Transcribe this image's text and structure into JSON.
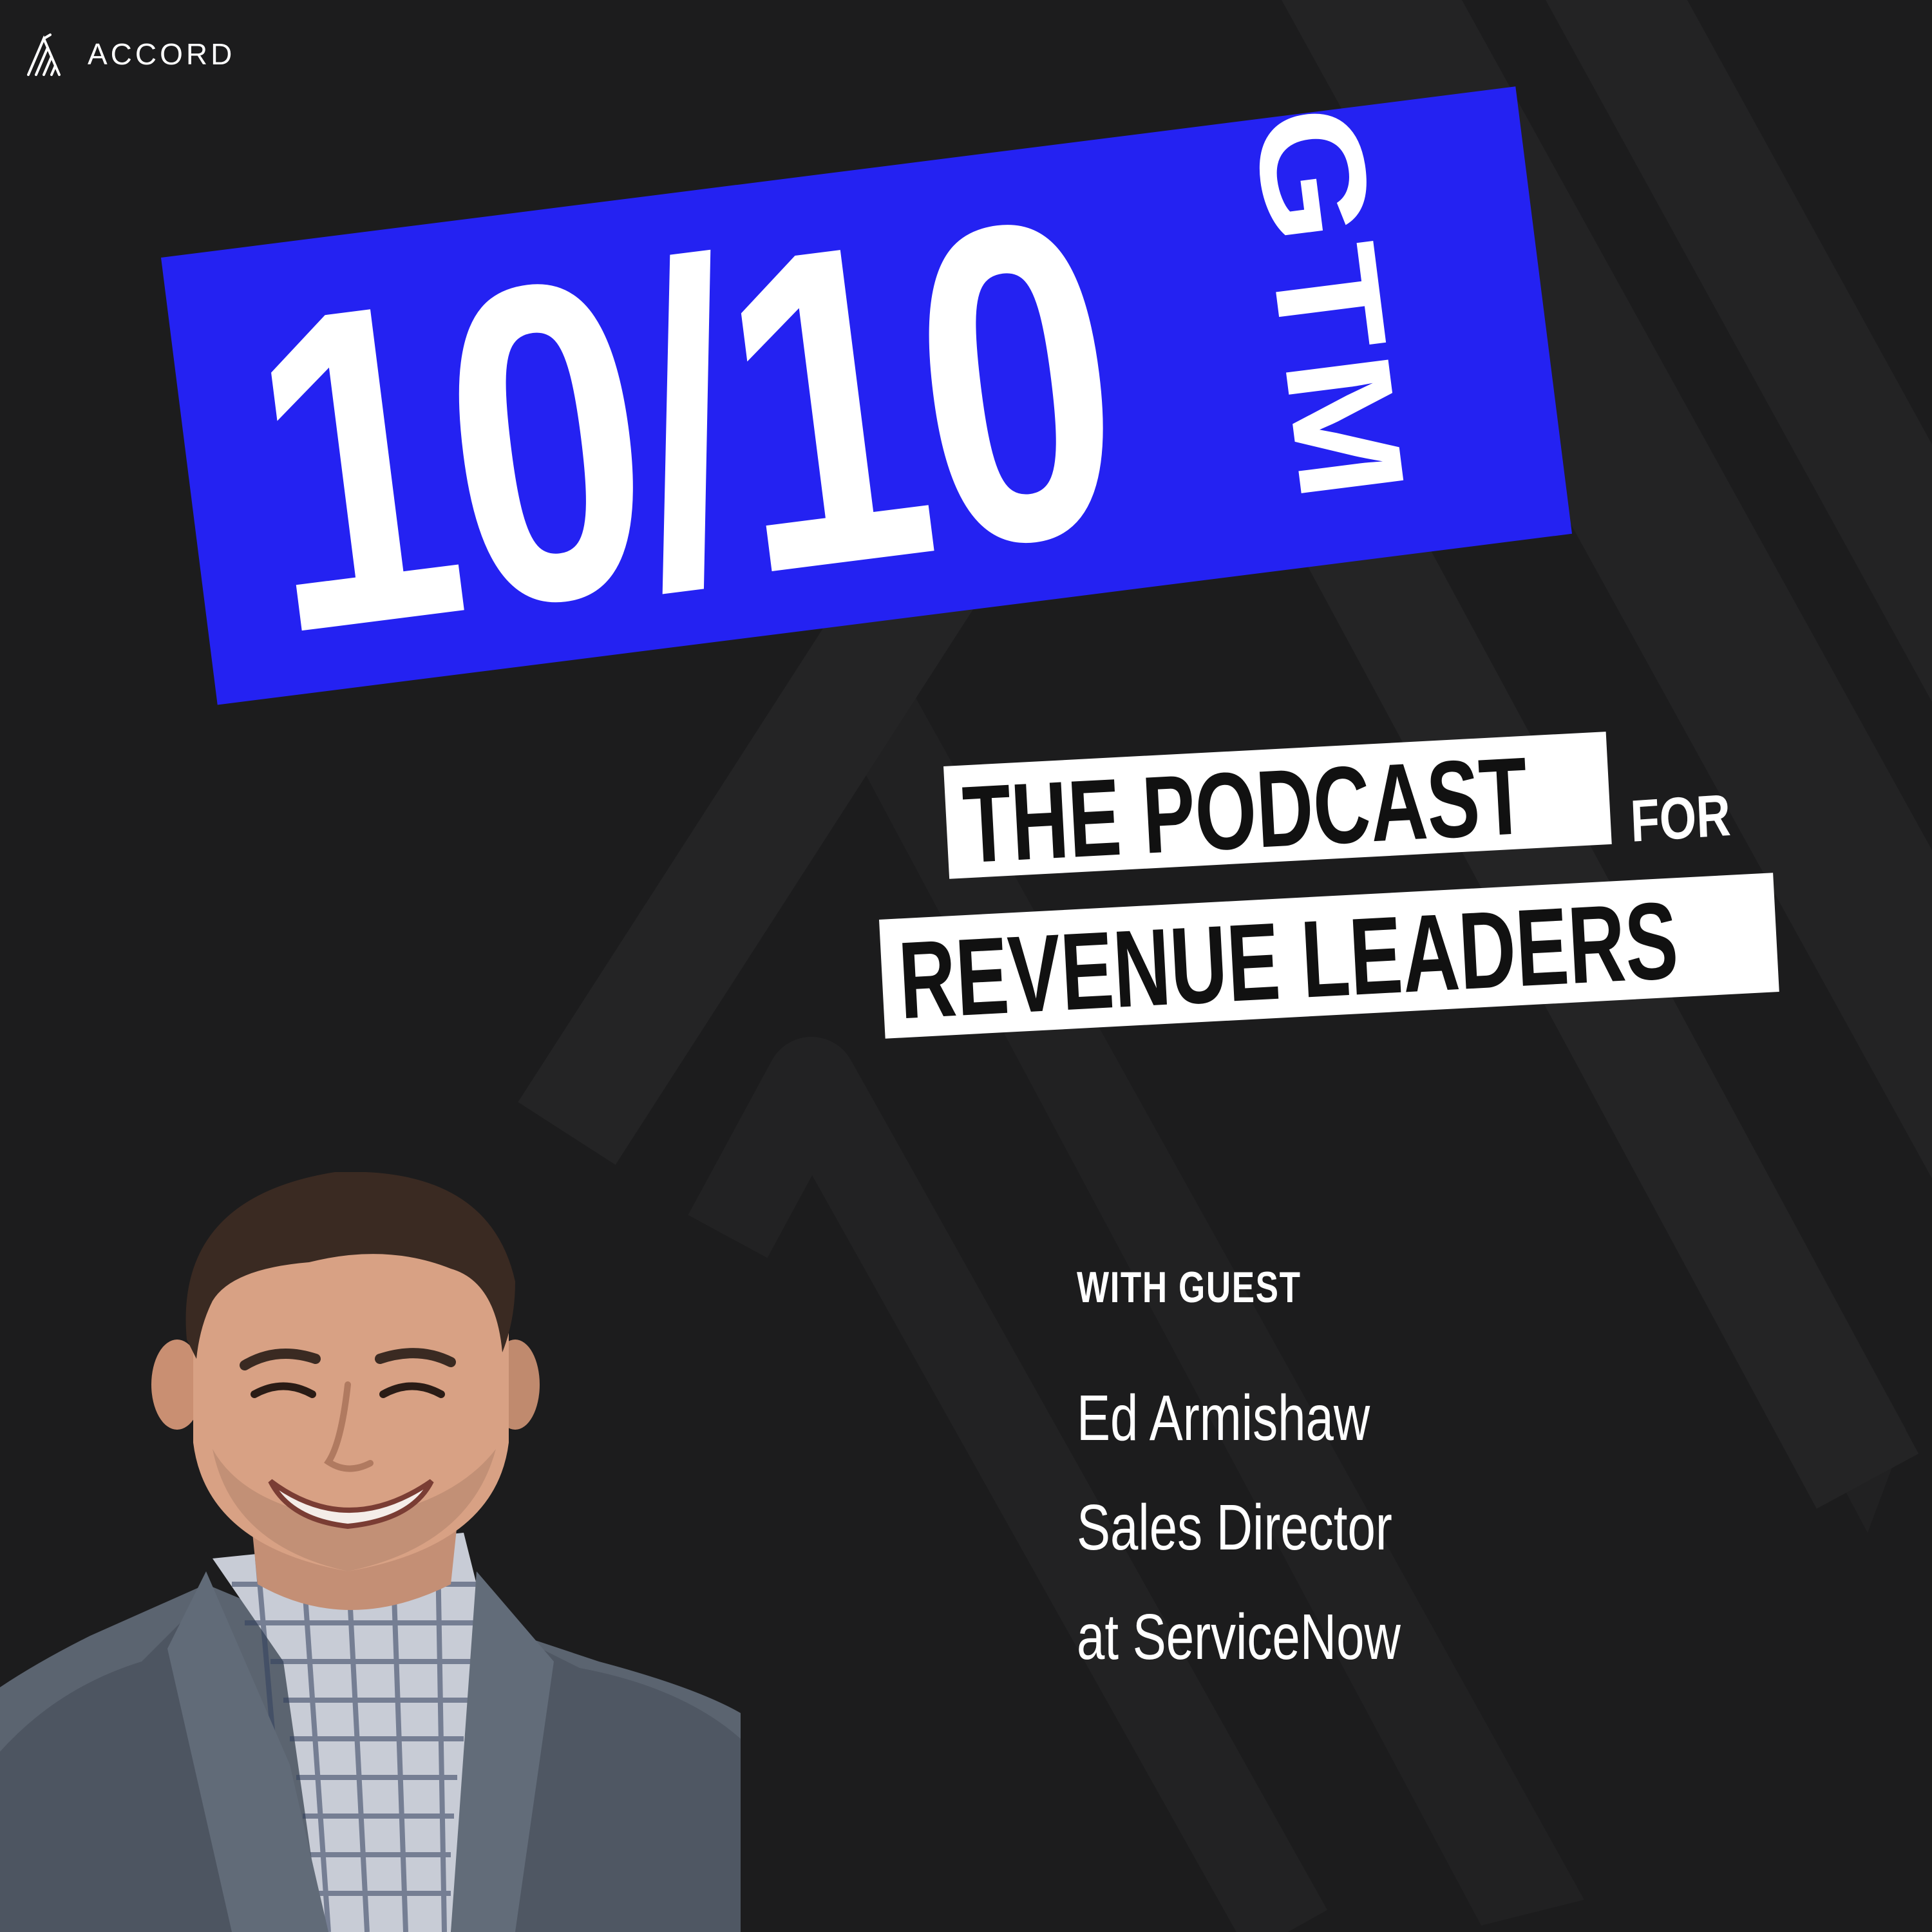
{
  "brand": {
    "name": "ACCORD",
    "logo_icon": "accord-logo-icon"
  },
  "title": {
    "main": "10/10",
    "side": "GTM"
  },
  "tagline": {
    "line1": "THE PODCAST",
    "connector": "FOR",
    "line2": "REVENUE LEADERS"
  },
  "guest": {
    "label": "WITH GUEST",
    "name": "Ed Armishaw",
    "role": "Sales Director",
    "company": "at ServiceNow",
    "photo": "guest-portrait"
  },
  "colors": {
    "background": "#1c1c1d",
    "accent_blue": "#2422f2",
    "text": "#ffffff",
    "tag_bg": "#ffffff",
    "tag_text": "#111111"
  }
}
